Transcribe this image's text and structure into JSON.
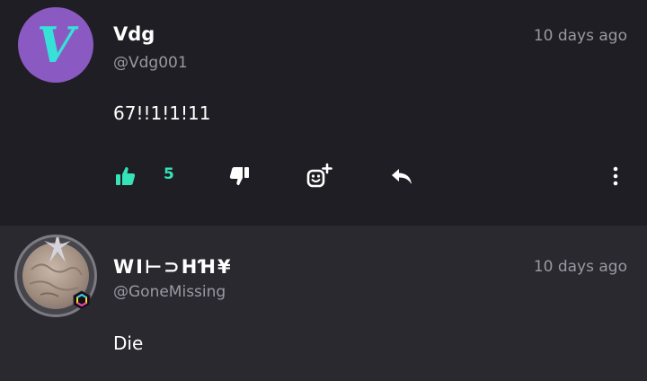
{
  "posts": [
    {
      "display_name": "Vdg",
      "handle": "@Vdg001",
      "time": "10 days ago",
      "content": "67!!1!1!11",
      "avatar_letter": "V",
      "likes": "5",
      "avatar_color": "#8a59c2",
      "avatar_letter_color": "#36e2d8"
    },
    {
      "display_name": "WI⊢⊃HꞪ¥",
      "handle": "@GoneMissing",
      "time": "10 days ago",
      "content": "Die"
    }
  ],
  "icons": {
    "like": "thumbs-up-icon",
    "dislike": "thumbs-down-icon",
    "react": "add-emoji-icon",
    "reply": "reply-icon",
    "more": "more-vertical-icon",
    "badge": "hexagon-badge-icon"
  },
  "colors": {
    "accent": "#36e2b8",
    "background": "#1f1e24",
    "second_background": "#2a2930",
    "muted_text": "#9a99a3"
  }
}
